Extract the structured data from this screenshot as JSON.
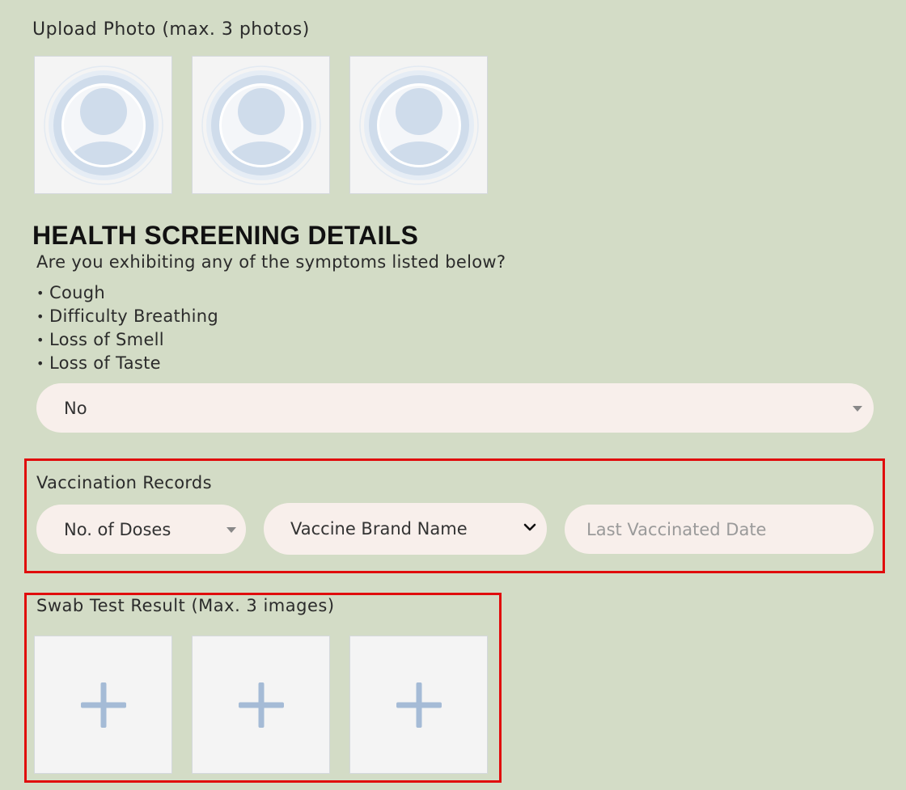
{
  "upload": {
    "label": "Upload Photo (max. 3 photos)",
    "slots": [
      {
        "icon": "avatar-placeholder-icon"
      },
      {
        "icon": "avatar-placeholder-icon"
      },
      {
        "icon": "avatar-placeholder-icon"
      }
    ]
  },
  "health": {
    "title": "HEALTH SCREENING DETAILS",
    "question": "Are you exhibiting any of the symptoms listed below?",
    "symptoms": [
      "Cough",
      "Difficulty Breathing",
      "Loss of Smell",
      "Loss of Taste"
    ],
    "answer": "No"
  },
  "vaccination": {
    "label": "Vaccination Records",
    "doses_placeholder": "No. of Doses",
    "brand_placeholder": "Vaccine Brand Name",
    "date_placeholder": "Last Vaccinated Date"
  },
  "swab": {
    "label": "Swab Test Result (Max. 3 images)",
    "slots": [
      {
        "icon": "plus-icon"
      },
      {
        "icon": "plus-icon"
      },
      {
        "icon": "plus-icon"
      }
    ]
  },
  "colors": {
    "background": "#d3dcc6",
    "field_fill": "#f8efeb",
    "highlight": "#e00c0c",
    "avatar": "#cfdceb",
    "plus": "#a5bbd6"
  }
}
